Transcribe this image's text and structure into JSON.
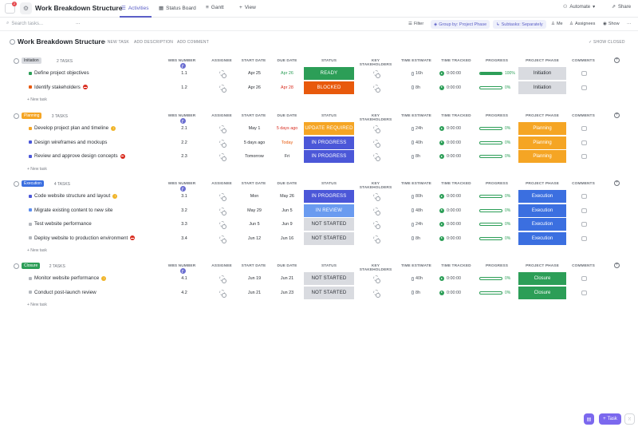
{
  "topbar": {
    "notification_count": "2",
    "workspace_title": "Work Breakdown Structure",
    "views": [
      {
        "label": "Activities",
        "icon": "list-icon"
      },
      {
        "label": "Status Board",
        "icon": "board-icon"
      },
      {
        "label": "Gantt",
        "icon": "gantt-icon"
      }
    ],
    "add_view_label": "View",
    "automate_label": "Automate",
    "share_label": "Share"
  },
  "toolbar": {
    "search_placeholder": "Search tasks...",
    "filter_label": "Filter",
    "group_by_label": "Group by: Project Phase",
    "subtasks_label": "Subtasks: Separately",
    "me_label": "Me",
    "assignees_label": "Assignees",
    "show_label": "Show"
  },
  "list_header": {
    "title": "Work Breakdown Structure",
    "new_task": "+ NEW TASK",
    "add_description": "ADD DESCRIPTION",
    "add_comment": "ADD COMMENT",
    "show_closed": "SHOW CLOSED"
  },
  "columns": {
    "wbs": "WBS NUMBER",
    "assignee": "ASSIGNEE",
    "start": "START DATE",
    "due": "DUE DATE",
    "status": "STATUS",
    "stakeholders": "KEY STAKEHOLDERS",
    "estimate": "TIME ESTIMATE",
    "tracked": "TIME TRACKED",
    "progress": "PROGRESS",
    "phase": "PROJECT PHASE",
    "comments": "COMMENTS"
  },
  "new_task_label": "+ New task",
  "groups": [
    {
      "name": "Initiation",
      "count": "2 TASKS",
      "tag_bg": "#d9dbe0",
      "tag_fg": "#2a2e34",
      "tasks": [
        {
          "name": "Define project objectives",
          "sq": "#2c9e57",
          "flag": "",
          "wbs": "1.1",
          "start": "Apr 25",
          "due": "Apr 26",
          "due_color": "#2c9e57",
          "status": "READY",
          "status_bg": "#2c9e57",
          "estimate": "16h",
          "tracked": "0:00:00",
          "progress": 100,
          "progress_label": "100%",
          "phase": "Initiation",
          "phase_bg": "#d9dbe0",
          "phase_fg": "#2a2e34"
        },
        {
          "name": "Identify stakeholders",
          "sq": "#e8590c",
          "flag": "block",
          "wbs": "1.2",
          "start": "Apr 26",
          "due": "Apr 28",
          "due_color": "#d92d20",
          "status": "BLOCKED",
          "status_bg": "#e8590c",
          "estimate": "8h",
          "tracked": "0:00:00",
          "progress": 0,
          "progress_label": "0%",
          "phase": "Initiation",
          "phase_bg": "#d9dbe0",
          "phase_fg": "#2a2e34"
        }
      ]
    },
    {
      "name": "Planning",
      "count": "3 TASKS",
      "tag_bg": "#f5a524",
      "tag_fg": "#ffffff",
      "tasks": [
        {
          "name": "Develop project plan and timeline",
          "sq": "#f5a524",
          "flag": "warn",
          "wbs": "2.1",
          "start": "May 1",
          "due": "5 days ago",
          "due_color": "#d92d20",
          "status": "UPDATE REQUIRED",
          "status_bg": "#f5a524",
          "estimate": "24h",
          "tracked": "0:00:00",
          "progress": 0,
          "progress_label": "0%",
          "phase": "Planning",
          "phase_bg": "#f5a524",
          "phase_fg": "#ffffff"
        },
        {
          "name": "Design wireframes and mockups",
          "sq": "#4b57d8",
          "flag": "",
          "wbs": "2.2",
          "start": "5 days ago",
          "due": "Today",
          "due_color": "#e8590c",
          "status": "IN PROGRESS",
          "status_bg": "#4b57d8",
          "estimate": "40h",
          "tracked": "0:00:00",
          "progress": 0,
          "progress_label": "0%",
          "phase": "Planning",
          "phase_bg": "#f5a524",
          "phase_fg": "#ffffff"
        },
        {
          "name": "Review and approve design concepts",
          "sq": "#4b57d8",
          "flag": "block",
          "wbs": "2.3",
          "start": "Tomorrow",
          "due": "Fri",
          "due_color": "#2a2e34",
          "status": "IN PROGRESS",
          "status_bg": "#4b57d8",
          "estimate": "8h",
          "tracked": "0:00:00",
          "progress": 0,
          "progress_label": "0%",
          "phase": "Planning",
          "phase_bg": "#f5a524",
          "phase_fg": "#ffffff"
        }
      ]
    },
    {
      "name": "Execution",
      "count": "4 TASKS",
      "tag_bg": "#3b6fe0",
      "tag_fg": "#ffffff",
      "tasks": [
        {
          "name": "Code website structure and layout",
          "sq": "#4b57d8",
          "flag": "warn",
          "wbs": "3.1",
          "start": "Mon",
          "due": "May 26",
          "due_color": "#2a2e34",
          "status": "IN PROGRESS",
          "status_bg": "#4b57d8",
          "estimate": "80h",
          "tracked": "0:00:00",
          "progress": 0,
          "progress_label": "0%",
          "phase": "Execution",
          "phase_bg": "#3b6fe0",
          "phase_fg": "#ffffff"
        },
        {
          "name": "Migrate existing content to new site",
          "sq": "#5b8def",
          "flag": "",
          "wbs": "3.2",
          "start": "May 29",
          "due": "Jun 5",
          "due_color": "#2a2e34",
          "status": "IN REVIEW",
          "status_bg": "#6a9bf0",
          "estimate": "48h",
          "tracked": "0:00:00",
          "progress": 0,
          "progress_label": "0%",
          "phase": "Execution",
          "phase_bg": "#3b6fe0",
          "phase_fg": "#ffffff"
        },
        {
          "name": "Test website performance",
          "sq": "#b4b8be",
          "flag": "",
          "wbs": "3.3",
          "start": "Jun 5",
          "due": "Jun 9",
          "due_color": "#2a2e34",
          "status": "NOT STARTED",
          "status_bg": "#d9dbe0",
          "estimate": "24h",
          "tracked": "0:00:00",
          "progress": 0,
          "progress_label": "0%",
          "phase": "Execution",
          "phase_bg": "#3b6fe0",
          "phase_fg": "#ffffff"
        },
        {
          "name": "Deploy website to production environment",
          "sq": "#b4b8be",
          "flag": "block",
          "wbs": "3.4",
          "start": "Jun 12",
          "due": "Jun 16",
          "due_color": "#2a2e34",
          "status": "NOT STARTED",
          "status_bg": "#d9dbe0",
          "estimate": "8h",
          "tracked": "0:00:00",
          "progress": 0,
          "progress_label": "0%",
          "phase": "Execution",
          "phase_bg": "#3b6fe0",
          "phase_fg": "#ffffff"
        }
      ]
    },
    {
      "name": "Closure",
      "count": "2 TASKS",
      "tag_bg": "#2c9e57",
      "tag_fg": "#ffffff",
      "tasks": [
        {
          "name": "Monitor website performance",
          "sq": "#b4b8be",
          "flag": "warn",
          "wbs": "4.1",
          "start": "Jun 19",
          "due": "Jun 21",
          "due_color": "#2a2e34",
          "status": "NOT STARTED",
          "status_bg": "#d9dbe0",
          "estimate": "40h",
          "tracked": "0:00:00",
          "progress": 0,
          "progress_label": "0%",
          "phase": "Closure",
          "phase_bg": "#2c9e57",
          "phase_fg": "#ffffff"
        },
        {
          "name": "Conduct post-launch review",
          "sq": "#b4b8be",
          "flag": "",
          "wbs": "4.2",
          "start": "Jun 21",
          "due": "Jun 23",
          "due_color": "#2a2e34",
          "status": "NOT STARTED",
          "status_bg": "#d9dbe0",
          "estimate": "8h",
          "tracked": "0:00:00",
          "progress": 0,
          "progress_label": "0%",
          "phase": "Closure",
          "phase_bg": "#2c9e57",
          "phase_fg": "#ffffff"
        }
      ]
    }
  ],
  "fab": {
    "task_label": "Task"
  }
}
